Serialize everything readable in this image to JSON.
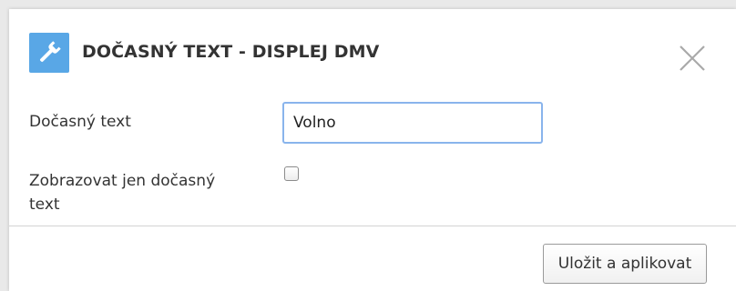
{
  "dialog": {
    "title": "DOČASNÝ TEXT - DISPLEJ DMV",
    "header_icon": "wrench-icon",
    "close_icon": "close-icon"
  },
  "form": {
    "temp_text_label": "Dočasný text",
    "temp_text_value": "Volno",
    "only_temp_label": "Zobrazovat jen dočasný text",
    "only_temp_checked": false
  },
  "footer": {
    "save_label": "Uložit a aplikovat"
  },
  "colors": {
    "icon_bg": "#59a7e6",
    "input_focus_border": "#89b4ec",
    "title_text": "#333333"
  }
}
